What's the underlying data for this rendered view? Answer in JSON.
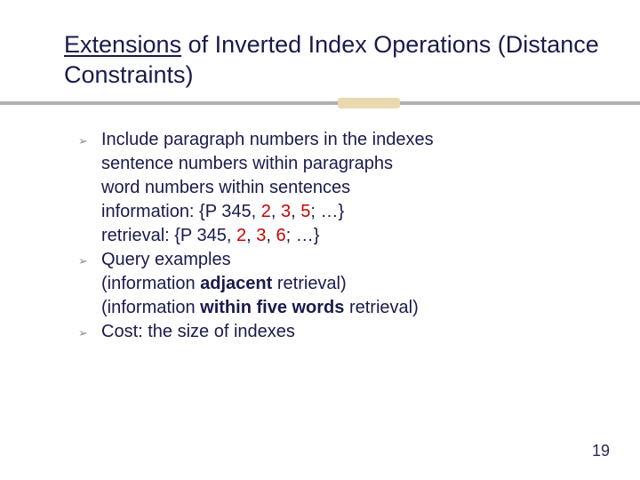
{
  "title_underlined": "Extensions",
  "title_rest": " of Inverted Index Operations (Distance Constraints)",
  "bullets": [
    {
      "lead": "Include paragraph numbers in the indexes",
      "subs": [
        {
          "text": "sentence numbers within paragraphs"
        },
        {
          "text": "word numbers within sentences"
        },
        {
          "prefix": "information: {P 345, ",
          "red": "2",
          "mid1": ", ",
          "red2": "3",
          "mid2": ", ",
          "red3": "5",
          "suffix": "; …}"
        },
        {
          "prefix": "retrieval: {P 345, ",
          "red": "2",
          "mid1": ", ",
          "red2": "3",
          "mid2": ", ",
          "red3": "6",
          "suffix": "; …}"
        }
      ]
    },
    {
      "lead": "Query examples",
      "subs": [
        {
          "prefix": "(information ",
          "bold": "adjacent",
          "suffix": " retrieval)"
        },
        {
          "prefix": "(information ",
          "bold": "within five words",
          "suffix": " retrieval)"
        }
      ]
    },
    {
      "lead": "Cost: the size of indexes",
      "subs": []
    }
  ],
  "marker_glyph": "➢",
  "page_number": "19"
}
